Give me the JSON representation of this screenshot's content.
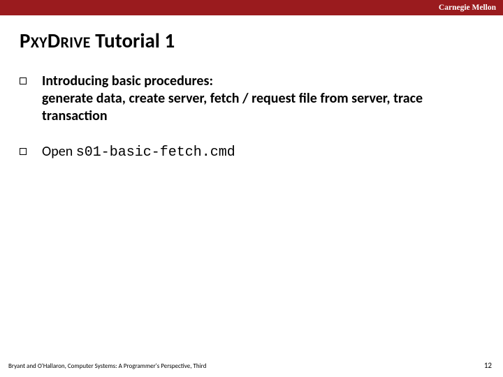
{
  "header": {
    "brand": "Carnegie Mellon"
  },
  "title": {
    "pxy_big1": "P",
    "pxy_small1": "XY",
    "pxy_big2": "D",
    "pxy_small2": "RIVE",
    "rest": " Tutorial 1"
  },
  "bullets": [
    {
      "lead": "Introducing basic procedures:",
      "rest": "generate data, create server, fetch / request file from server, trace transaction"
    }
  ],
  "open_bullet": {
    "open": "Open ",
    "code": "s01-basic-fetch.cmd"
  },
  "footer": "Bryant and O'Hallaron, Computer Systems: A Programmer's Perspective, Third",
  "page": "12"
}
